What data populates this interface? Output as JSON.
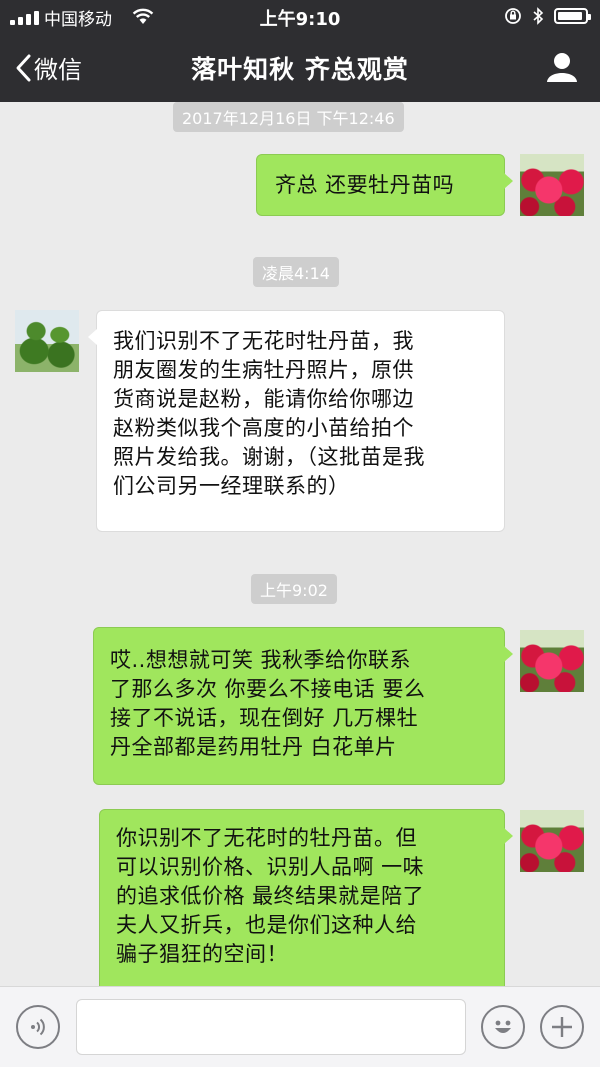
{
  "status_bar": {
    "carrier": "中国移动",
    "time": "上午9:10"
  },
  "nav": {
    "back_label": "微信",
    "title": "落叶知秋 齐总观赏"
  },
  "messages": [
    {
      "type": "timestamp",
      "text": "2017年12月16日 下午12:46"
    },
    {
      "type": "message",
      "sender": "me",
      "text": "齐总 还要牡丹苗吗"
    },
    {
      "type": "timestamp",
      "text": "凌晨4:14"
    },
    {
      "type": "message",
      "sender": "other",
      "lines": [
        "我们识别不了无花时牡丹苗，我",
        "朋友圈发的生病牡丹照片，原供",
        "货商说是赵粉，能请你给你哪边",
        "赵粉类似我个高度的小苗给拍个",
        "照片发给我。谢谢，（这批苗是我",
        "们公司另一经理联系的）"
      ]
    },
    {
      "type": "timestamp",
      "text": "上午9:02"
    },
    {
      "type": "message",
      "sender": "me",
      "lines": [
        "哎..想想就可笑 我秋季给你联系",
        "了那么多次 你要么不接电话 要么",
        "接了不说话，现在倒好 几万棵牡",
        "丹全部都是药用牡丹 白花单片"
      ]
    },
    {
      "type": "message",
      "sender": "me",
      "lines": [
        "你识别不了无花时的牡丹苗。但",
        "可以识别价格、识别人品啊 一味",
        "的追求低价格 最终结果就是陪了",
        "夫人又折兵，也是你们这种人给",
        "骗子猖狂的空间！"
      ]
    }
  ],
  "input_bar": {
    "value": "",
    "placeholder": ""
  },
  "colors": {
    "topbar": "#2e2e31",
    "chat_background": "#ebebeb",
    "my_bubble": "#a0e65d",
    "other_bubble": "#ffffff",
    "timestamp_pill": "#cecece"
  },
  "icons": {
    "back": "chevron-left-icon",
    "profile": "user-icon",
    "voice": "voice-icon",
    "emoji": "emoji-icon",
    "more": "plus-icon"
  }
}
